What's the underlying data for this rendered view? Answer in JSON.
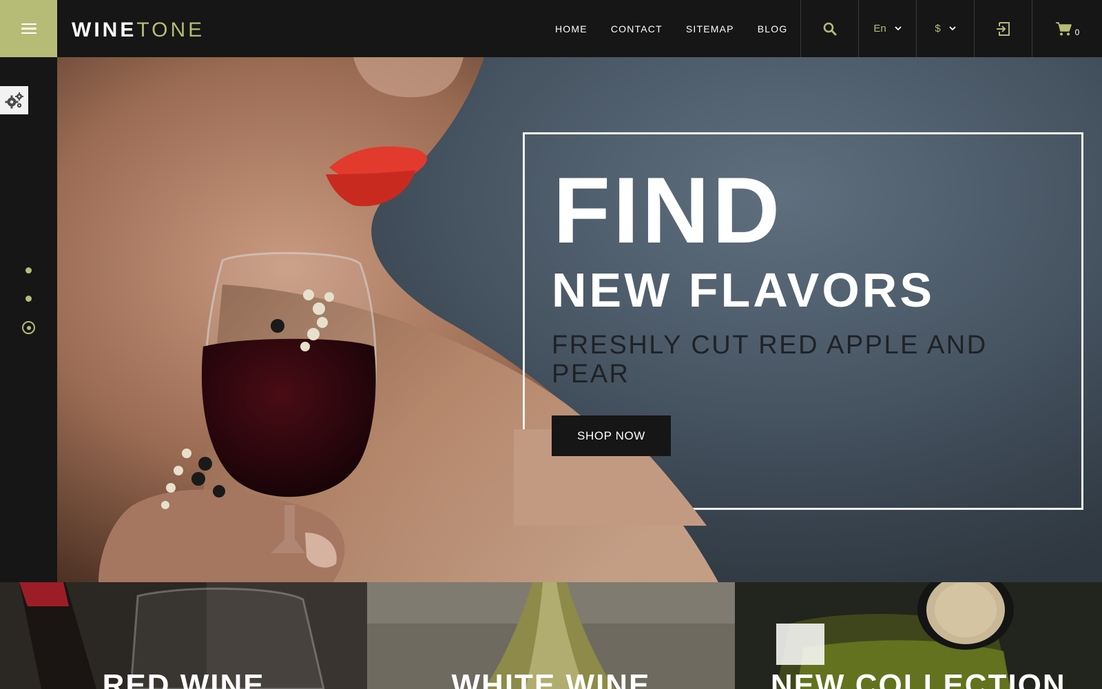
{
  "brand": {
    "logo_bold": "WINE",
    "logo_light": "TONE"
  },
  "nav": {
    "items": [
      "HOME",
      "CONTACT",
      "SITEMAP",
      "BLOG"
    ]
  },
  "header": {
    "language": "En",
    "currency": "$",
    "cart_count": "0"
  },
  "icons": {
    "menu": "hamburger-menu-icon",
    "search": "search-icon",
    "language_caret": "chevron-down-icon",
    "currency_caret": "chevron-down-icon",
    "login": "login-icon",
    "cart": "shopping-cart-icon",
    "settings": "gears-icon"
  },
  "hero": {
    "title": "FIND",
    "subtitle": "NEW FLAVORS",
    "tagline": "FRESHLY CUT RED APPLE AND PEAR",
    "cta": "SHOP NOW"
  },
  "slider": {
    "total": 3,
    "active": 3
  },
  "categories": [
    "RED WINE",
    "WHITE WINE",
    "NEW COLLECTION"
  ],
  "colors": {
    "accent": "#b6bc76",
    "dark": "#161616",
    "white": "#ffffff"
  }
}
